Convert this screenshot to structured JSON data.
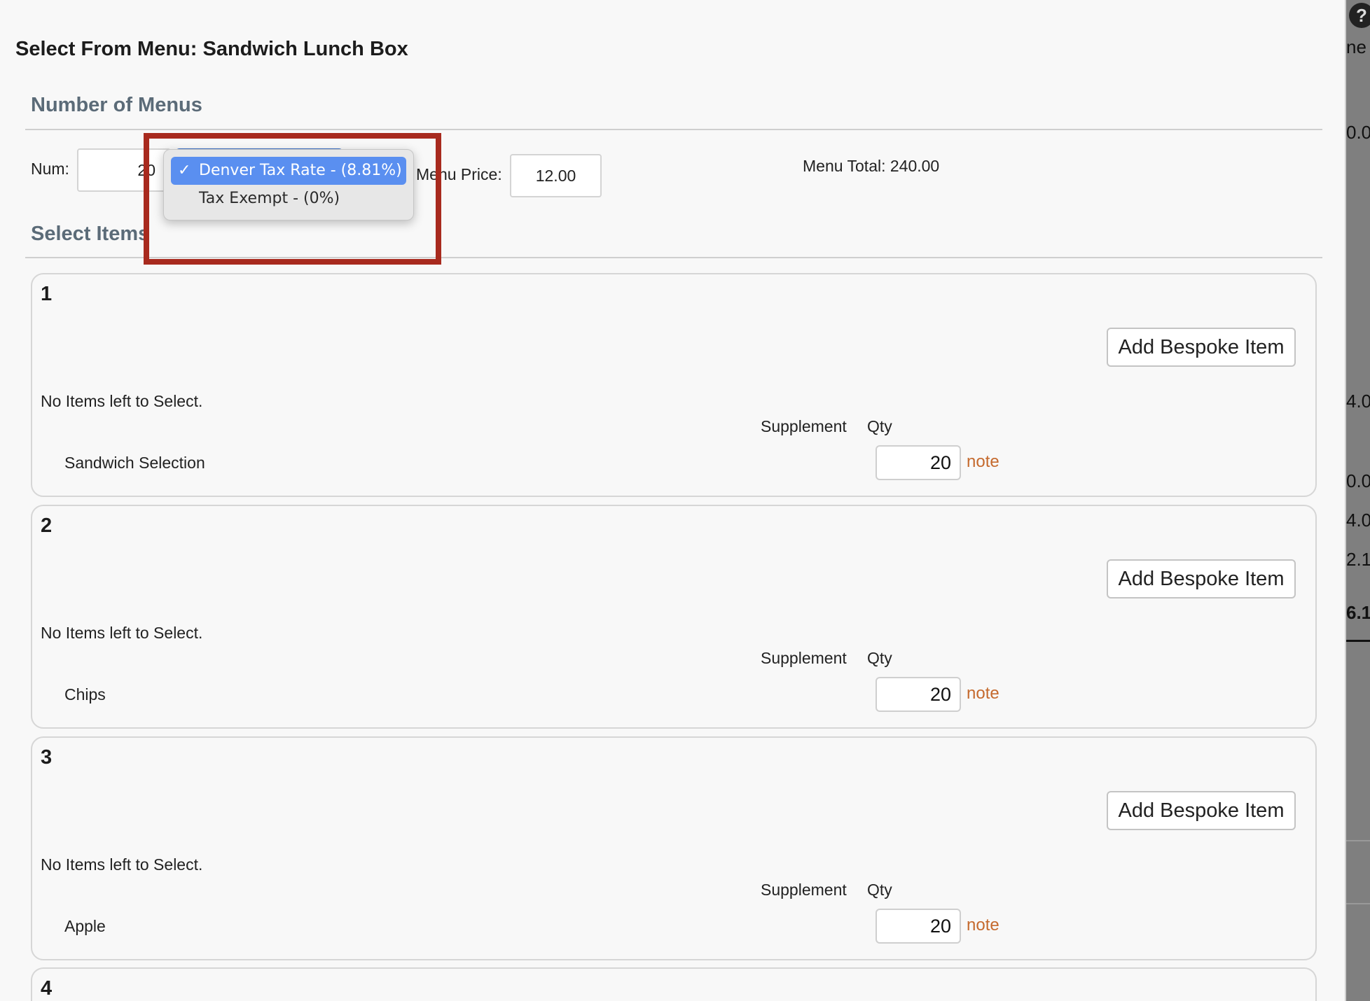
{
  "background": {
    "fragments": [
      "ne",
      "0.0",
      "4.0",
      "0.0",
      "4.0",
      "2.1",
      "6.1"
    ]
  },
  "modal": {
    "title": "Select From Menu: Sandwich Lunch Box",
    "number_of_menus": {
      "heading": "Number of Menus",
      "num_label": "Num:",
      "num_value": "20",
      "menu_price_label": "Menu Price:",
      "menu_price_value": "12.00",
      "menu_total": "Menu Total: 240.00"
    },
    "tax_dropdown": {
      "options": [
        {
          "label": "Denver Tax Rate - (8.81%)",
          "selected": true
        },
        {
          "label": "Tax Exempt - (0%)",
          "selected": false
        }
      ],
      "check_glyph": "✓"
    },
    "select_items": {
      "heading": "Select Items",
      "groups": [
        {
          "number": "1",
          "button": "Add Bespoke Item",
          "no_items": "No Items left to Select.",
          "supplement": "Supplement",
          "qty_label": "Qty",
          "item": "Sandwich Selection",
          "qty": "20",
          "note": "note"
        },
        {
          "number": "2",
          "button": "Add Bespoke Item",
          "no_items": "No Items left to Select.",
          "supplement": "Supplement",
          "qty_label": "Qty",
          "item": "Chips",
          "qty": "20",
          "note": "note"
        },
        {
          "number": "3",
          "button": "Add Bespoke Item",
          "no_items": "No Items left to Select.",
          "supplement": "Supplement",
          "qty_label": "Qty",
          "item": "Apple",
          "qty": "20",
          "note": "note"
        },
        {
          "number": "4"
        }
      ]
    }
  },
  "colors": {
    "highlight": "#a82a1e",
    "selected_option": "#5a8ff0",
    "note_link": "#c56a2e",
    "heading": "#5b6b78"
  }
}
